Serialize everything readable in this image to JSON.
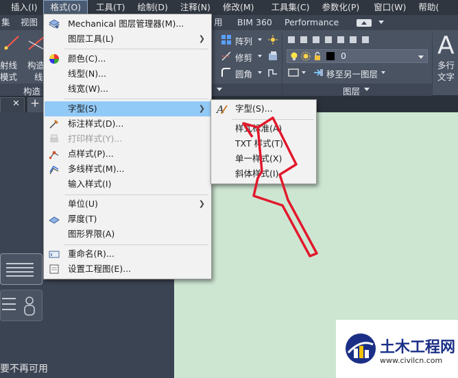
{
  "menubar": {
    "items": [
      {
        "label": "插入(I)"
      },
      {
        "label": "格式(O)"
      },
      {
        "label": "工具(T)"
      },
      {
        "label": "绘制(D)"
      },
      {
        "label": "注释(N)"
      },
      {
        "label": "修改(M)"
      },
      {
        "label": "工具集(C)"
      },
      {
        "label": "参数化(P)"
      },
      {
        "label": "窗口(W)"
      },
      {
        "label": "帮助("
      }
    ]
  },
  "ribbon": {
    "tabs": {
      "tab0": "集",
      "tab1": "视图",
      "tab2": "用",
      "tab3": "BIM 360",
      "tab4": "Performance"
    },
    "left_labels": {
      "ray_line1": "射线",
      "ray_line2": "模式",
      "construct_line1": "构造",
      "construct_line2": "线",
      "construct_group": "构造"
    },
    "modify": {
      "array": "阵列",
      "trim": "修剪",
      "fillet": "圆角"
    },
    "layers": {
      "layer_value": "0",
      "move_to_layer": "移至另一图层",
      "group_label": "图层"
    },
    "text": {
      "line1": "多行",
      "line2": "文字",
      "big_letter": "A"
    }
  },
  "format_menu": {
    "items": [
      {
        "label": "Mechanical 图层管理器(M)..."
      },
      {
        "label": "图层工具(L)"
      },
      {
        "label": "颜色(C)..."
      },
      {
        "label": "线型(N)..."
      },
      {
        "label": "线宽(W)..."
      },
      {
        "label": "字型(S)"
      },
      {
        "label": "标注样式(D)..."
      },
      {
        "label": "打印样式(Y)..."
      },
      {
        "label": "点样式(P)..."
      },
      {
        "label": "多线样式(M)..."
      },
      {
        "label": "输入样式(I)"
      },
      {
        "label": "单位(U)"
      },
      {
        "label": "厚度(T)"
      },
      {
        "label": "图形界限(A)"
      },
      {
        "label": "重命名(R)..."
      },
      {
        "label": "设置工程图(E)..."
      }
    ]
  },
  "text_style_submenu": {
    "items": [
      {
        "label": "字型(S)..."
      },
      {
        "label": "样式标准(A)"
      },
      {
        "label": "TXT 样式(T)"
      },
      {
        "label": "单一样式(X)"
      },
      {
        "label": "斜体样式(I)"
      }
    ]
  },
  "left_panel": {
    "footer_text": "要不再可用"
  },
  "watermark": {
    "title": "土木工程网",
    "url": "www.civilcn.com"
  },
  "colors": {
    "menu_highlight": "#91c9f7",
    "canvas": "#cde6d2",
    "annotation_arrow": "#e2182b",
    "ribbon_bg": "#4a5362",
    "watermark_text": "#1b2f86"
  }
}
